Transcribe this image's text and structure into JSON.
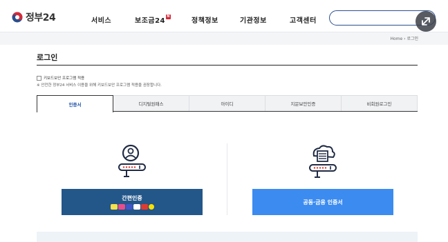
{
  "header": {
    "logo_text": "정부24",
    "nav": [
      {
        "label": "서비스"
      },
      {
        "label": "보조금24",
        "badge": "N"
      },
      {
        "label": "정책정보"
      },
      {
        "label": "기관정보"
      },
      {
        "label": "고객센터"
      }
    ],
    "search": {
      "placeholder": ""
    }
  },
  "breadcrumb": {
    "home": "Home",
    "separator": "›",
    "current": "로그인"
  },
  "page": {
    "title": "로그인",
    "keyboard_security_label": "키보드보안 프로그램 적용",
    "keyboard_security_note": "※ 안전한 정부24 서비스 이용을 위해 키보드보안 프로그램 적용을 권장합니다."
  },
  "tabs": [
    {
      "label": "인증서",
      "active": true
    },
    {
      "label": "디지털원패스",
      "active": false
    },
    {
      "label": "아이디",
      "active": false
    },
    {
      "label": "지문보안인증",
      "active": false
    },
    {
      "label": "비회원로그인",
      "active": false
    }
  ],
  "login_options": {
    "simple_auth": {
      "label": "간편인증",
      "apps": [
        {
          "name": "kakao",
          "color": "#f7e04a"
        },
        {
          "name": "pass",
          "color": "#e84c8b"
        },
        {
          "name": "naver",
          "color": "#3f56c8"
        },
        {
          "name": "toss",
          "color": "#ffffff"
        },
        {
          "name": "payco",
          "color": "#e03a2e"
        },
        {
          "name": "kakaotalk",
          "color": "#f9e000"
        }
      ]
    },
    "joint_cert": {
      "label": "공동·금융 인증서"
    }
  },
  "colors": {
    "primary_dark": "#235689",
    "primary_light": "#3b8bf0",
    "active_tab": "#1d4fa8"
  }
}
